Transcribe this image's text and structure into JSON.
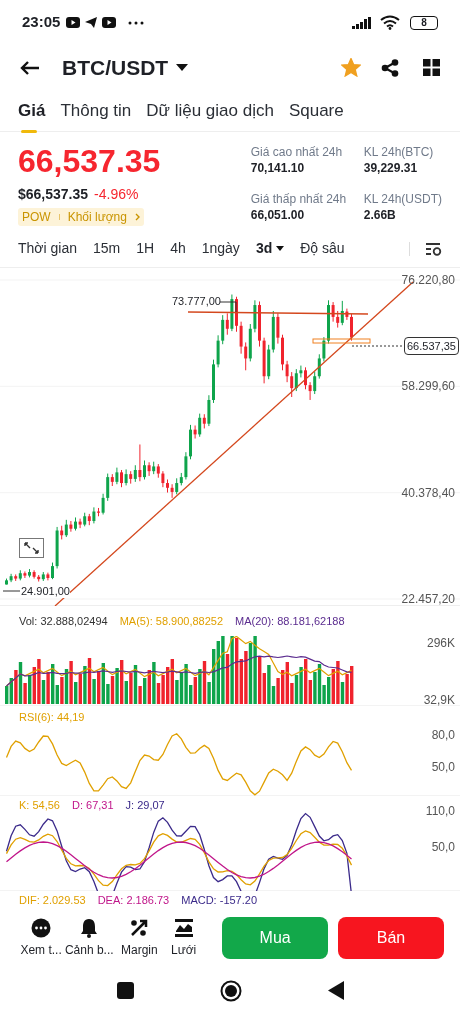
{
  "status_bar": {
    "time": "23:05",
    "battery": "8"
  },
  "header": {
    "title": "BTC/USDT",
    "favorite": true
  },
  "tabs": [
    {
      "label": "Giá",
      "selected": true
    },
    {
      "label": "Thông tin",
      "selected": false
    },
    {
      "label": "Dữ liệu giao dịch",
      "selected": false
    },
    {
      "label": "Square",
      "selected": false
    }
  ],
  "price": {
    "last": "66,537.35",
    "fiat": "$66,537.35",
    "change": "-4.96%",
    "tags": [
      "POW",
      "Khối lượng"
    ]
  },
  "stats": [
    {
      "label": "Giá cao nhất 24h",
      "value": "70,141.10"
    },
    {
      "label": "KL 24h(BTC)",
      "value": "39,229.31"
    },
    {
      "label": "Giá thấp nhất 24h",
      "value": "66,051.00"
    },
    {
      "label": "KL 24h(USDT)",
      "value": "2.66B"
    }
  ],
  "intervals": [
    {
      "label": "Thời gian",
      "kind": "option",
      "selected": false
    },
    {
      "label": "15m",
      "kind": "option",
      "selected": false
    },
    {
      "label": "1H",
      "kind": "option",
      "selected": false
    },
    {
      "label": "4h",
      "kind": "option",
      "selected": false
    },
    {
      "label": "1ngày",
      "kind": "option",
      "selected": false
    },
    {
      "label": "3d",
      "kind": "dropdown",
      "selected": true
    },
    {
      "label": "Độ sâu",
      "kind": "option",
      "selected": false
    }
  ],
  "chart": {
    "high_label": "73.777,00",
    "low_label": "24.901,00",
    "last_price": "66.537,35",
    "chart_data": {
      "type": "candlestick",
      "ylim": [
        22457.2,
        76220.8
      ],
      "yticks": [
        {
          "value": 22457.2,
          "label": "22.457,20"
        },
        {
          "value": 40378.4,
          "label": "40.378,40"
        },
        {
          "value": 58299.6,
          "label": "58.299,60"
        },
        {
          "value": 76220.8,
          "label": "76.220,80"
        }
      ],
      "ohlc": [
        [
          24901,
          25900,
          24901,
          25600
        ],
        [
          25600,
          26700,
          25300,
          26300
        ],
        [
          26300,
          26600,
          25500,
          25900
        ],
        [
          25900,
          27300,
          25600,
          26800
        ],
        [
          26800,
          27100,
          26000,
          26400
        ],
        [
          26400,
          27500,
          26100,
          27000
        ],
        [
          27000,
          27300,
          25900,
          26200
        ],
        [
          26200,
          26500,
          25400,
          25800
        ],
        [
          25800,
          27000,
          25500,
          26600
        ],
        [
          26600,
          26900,
          25600,
          26000
        ],
        [
          26000,
          28600,
          25800,
          28000
        ],
        [
          28000,
          34600,
          27600,
          34000
        ],
        [
          34000,
          34800,
          32500,
          33200
        ],
        [
          33200,
          35800,
          32900,
          35000
        ],
        [
          35000,
          35600,
          33800,
          34300
        ],
        [
          34300,
          36200,
          34000,
          35500
        ],
        [
          35500,
          36000,
          34400,
          35000
        ],
        [
          35000,
          37000,
          34700,
          36400
        ],
        [
          36400,
          36800,
          34900,
          35600
        ],
        [
          35600,
          37900,
          35200,
          37200
        ],
        [
          37200,
          37800,
          36400,
          37000
        ],
        [
          37000,
          40200,
          36700,
          39500
        ],
        [
          39500,
          43600,
          39000,
          43000
        ],
        [
          43000,
          43500,
          41500,
          42200
        ],
        [
          42200,
          44600,
          41800,
          43800
        ],
        [
          43800,
          44200,
          41300,
          42000
        ],
        [
          42000,
          44300,
          41600,
          43500
        ],
        [
          43500,
          44000,
          41900,
          42700
        ],
        [
          42700,
          45000,
          42200,
          44200
        ],
        [
          44200,
          48500,
          42300,
          43000
        ],
        [
          43000,
          45800,
          42600,
          45000
        ],
        [
          45000,
          45500,
          43200,
          44000
        ],
        [
          44000,
          45600,
          43500,
          44800
        ],
        [
          44800,
          45200,
          42900,
          43600
        ],
        [
          43600,
          44000,
          41300,
          42000
        ],
        [
          42000,
          42600,
          40400,
          41200
        ],
        [
          41200,
          41800,
          39500,
          40500
        ],
        [
          40500,
          42800,
          40100,
          42000
        ],
        [
          42000,
          43700,
          41600,
          43000
        ],
        [
          43000,
          47200,
          42600,
          46500
        ],
        [
          46500,
          51800,
          46000,
          51000
        ],
        [
          51000,
          51700,
          49500,
          50200
        ],
        [
          50200,
          53700,
          49800,
          53000
        ],
        [
          53000,
          53600,
          51200,
          52000
        ],
        [
          52000,
          56800,
          51600,
          56000
        ],
        [
          56000,
          62800,
          55500,
          62000
        ],
        [
          62000,
          66900,
          61500,
          66000
        ],
        [
          66000,
          70300,
          65400,
          69500
        ],
        [
          69500,
          70600,
          67000,
          68000
        ],
        [
          68000,
          73777,
          67600,
          73000
        ],
        [
          73000,
          73400,
          67500,
          68500
        ],
        [
          68500,
          69200,
          63800,
          65000
        ],
        [
          65000,
          65700,
          61000,
          63000
        ],
        [
          63000,
          68800,
          62500,
          68000
        ],
        [
          68000,
          72800,
          67400,
          72000
        ],
        [
          72000,
          72600,
          65000,
          66000
        ],
        [
          66000,
          66500,
          58800,
          60000
        ],
        [
          60000,
          65300,
          59500,
          64500
        ],
        [
          64500,
          71000,
          64000,
          70000
        ],
        [
          70000,
          70600,
          65500,
          66500
        ],
        [
          66500,
          67000,
          61000,
          62000
        ],
        [
          62000,
          62600,
          59000,
          60000
        ],
        [
          60000,
          60700,
          56500,
          58000
        ],
        [
          58000,
          61200,
          57500,
          60500
        ],
        [
          60500,
          61800,
          59800,
          61000
        ],
        [
          61000,
          61500,
          57800,
          58500
        ],
        [
          58500,
          59000,
          56000,
          57500
        ],
        [
          57500,
          60800,
          57000,
          60000
        ],
        [
          60000,
          63700,
          59600,
          63000
        ],
        [
          63000,
          66600,
          62500,
          66000
        ],
        [
          66000,
          72800,
          65500,
          72000
        ],
        [
          72000,
          72500,
          69200,
          70000
        ],
        [
          70000,
          71000,
          68200,
          69000
        ],
        [
          69000,
          72700,
          68600,
          71000
        ],
        [
          70900,
          71400,
          69500,
          70000
        ],
        [
          70000,
          70500,
          66000,
          66537.35
        ]
      ]
    }
  },
  "volume": {
    "legend": [
      {
        "text": "Vol: 32.888,02494",
        "color": "#333333"
      },
      {
        "text": "MA(5): 58.900,88252",
        "color": "#e0a000"
      },
      {
        "text": "MA(20): 88.181,62188",
        "color": "#5b2c8f"
      }
    ],
    "y_labels": [
      "296K",
      "32,9K"
    ]
  },
  "rsi": {
    "legend": [
      {
        "text": "RSI(6): 44,19",
        "color": "#e0a000"
      }
    ],
    "y_labels": [
      "80,0",
      "50,0"
    ]
  },
  "kdj": {
    "legend": [
      {
        "text": "K: 54,56",
        "color": "#e0a000"
      },
      {
        "text": "D: 67,31",
        "color": "#c0168a"
      },
      {
        "text": "J: 29,07",
        "color": "#3b2a8a"
      }
    ],
    "y_labels": [
      "110,0",
      "50,0"
    ]
  },
  "macd": {
    "legend": [
      {
        "text": "DIF: 2.029.53",
        "color": "#e0a000"
      },
      {
        "text": "DEA: 2.186.73",
        "color": "#c0168a"
      },
      {
        "text": "MACD: -157.20",
        "color": "#3b2a8a"
      }
    ]
  },
  "actions": [
    {
      "label": "Xem t...",
      "kind": "more"
    },
    {
      "label": "Cảnh b...",
      "kind": "alert"
    },
    {
      "label": "Margin",
      "kind": "margin"
    },
    {
      "label": "Lưới",
      "kind": "grid"
    }
  ],
  "trade_buttons": [
    {
      "label": "Mua",
      "kind": "buy"
    },
    {
      "label": "Bán",
      "kind": "sell"
    }
  ]
}
